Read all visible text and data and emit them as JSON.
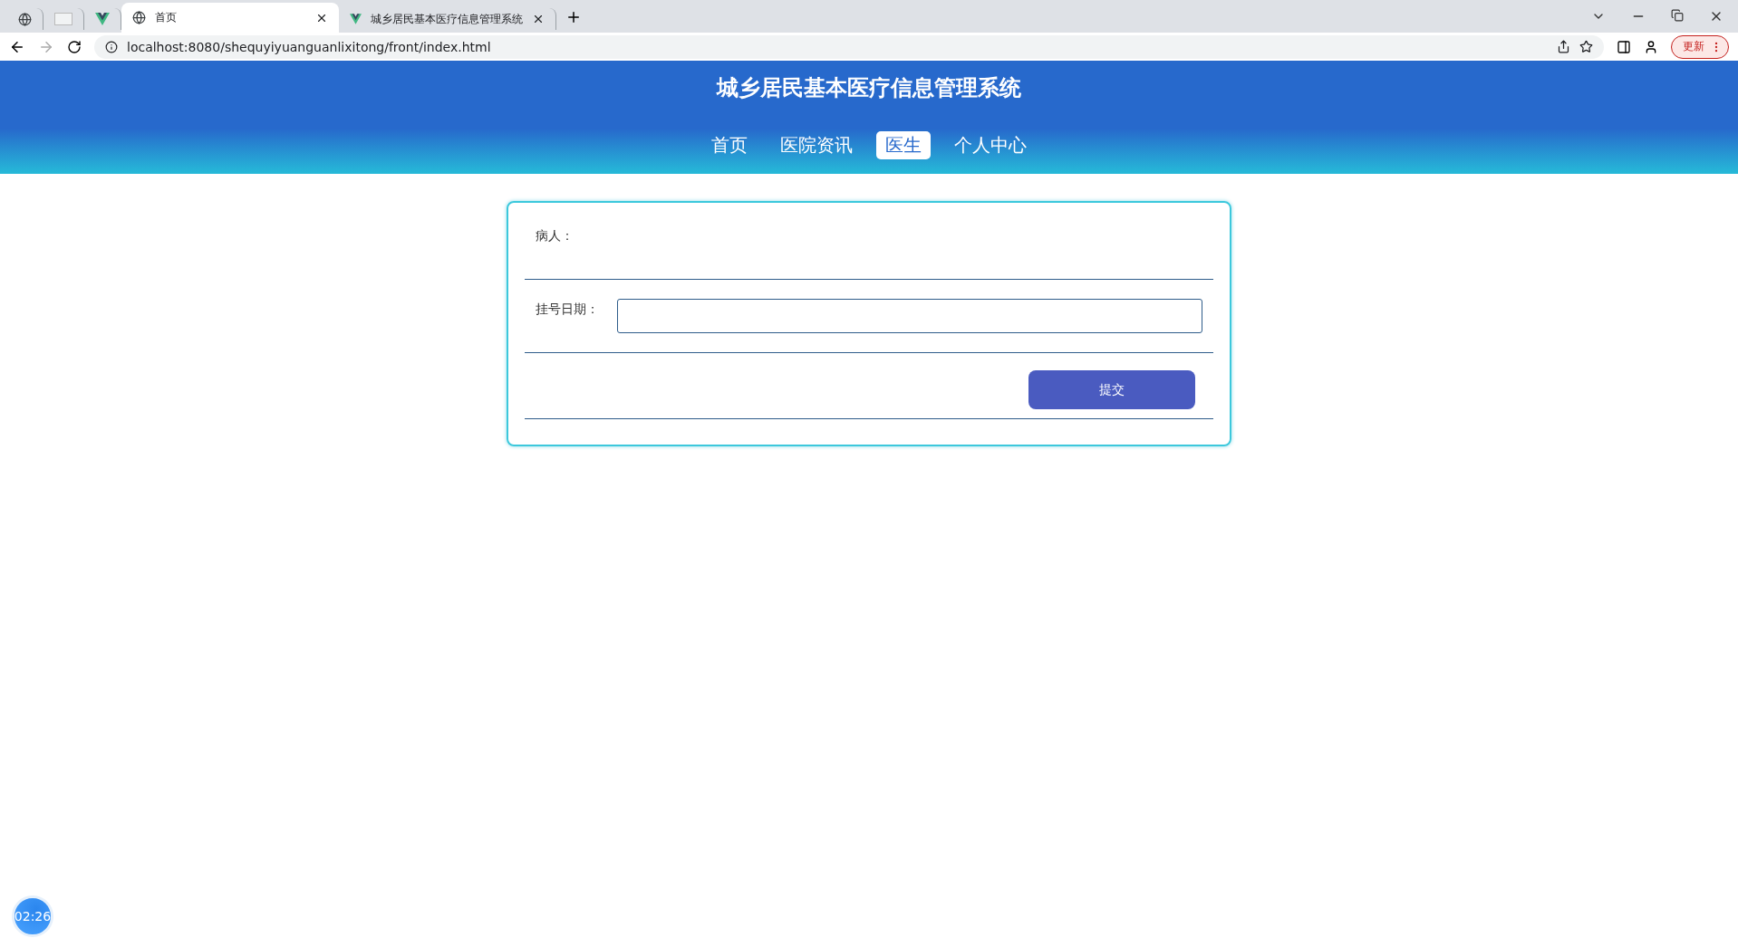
{
  "browser": {
    "tabs": [
      {
        "kind": "globe",
        "selected": false
      },
      {
        "kind": "blank",
        "selected": false
      },
      {
        "kind": "vue",
        "selected": false
      },
      {
        "kind": "globe",
        "title": "首页",
        "selected": true
      },
      {
        "kind": "vue",
        "title": "城乡居民基本医疗信息管理系统",
        "selected": false
      }
    ],
    "address": "localhost:8080/shequyiyuanguanlixitong/front/index.html",
    "update_button": "更新"
  },
  "header": {
    "title": "城乡居民基本医疗信息管理系统",
    "nav": [
      {
        "label": "首页",
        "selected": false
      },
      {
        "label": "医院资讯",
        "selected": false
      },
      {
        "label": "医生",
        "selected": true
      },
      {
        "label": "个人中心",
        "selected": false
      }
    ]
  },
  "form": {
    "rows": [
      {
        "kind": "text",
        "label": "病人："
      },
      {
        "kind": "input",
        "label": "挂号日期："
      }
    ],
    "submit": "提交"
  },
  "timer": "02:26"
}
